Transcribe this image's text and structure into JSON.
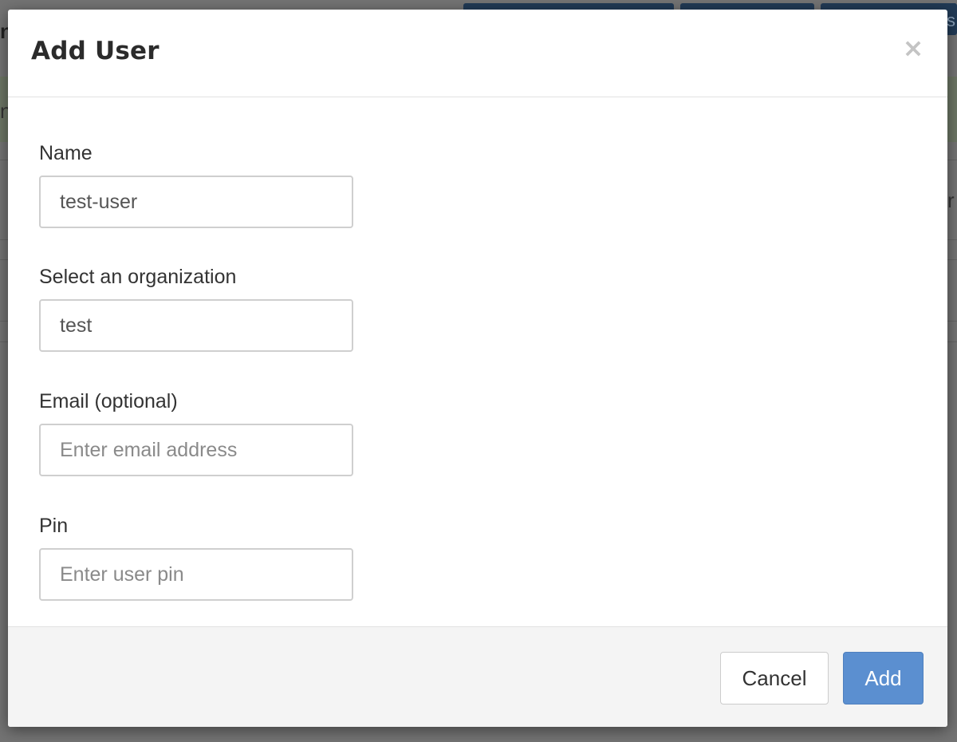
{
  "modal": {
    "title": "Add User",
    "close_glyph": "×"
  },
  "form": {
    "name": {
      "label": "Name",
      "value": "test-user",
      "placeholder": ""
    },
    "organization": {
      "label": "Select an organization",
      "value": "test"
    },
    "email": {
      "label": "Email (optional)",
      "value": "",
      "placeholder": "Enter email address"
    },
    "pin": {
      "label": "Pin",
      "value": "",
      "placeholder": "Enter user pin"
    }
  },
  "footer": {
    "cancel_label": "Cancel",
    "add_label": "Add"
  },
  "colors": {
    "primary": "#5b8fd0",
    "overlay": "#737373"
  }
}
